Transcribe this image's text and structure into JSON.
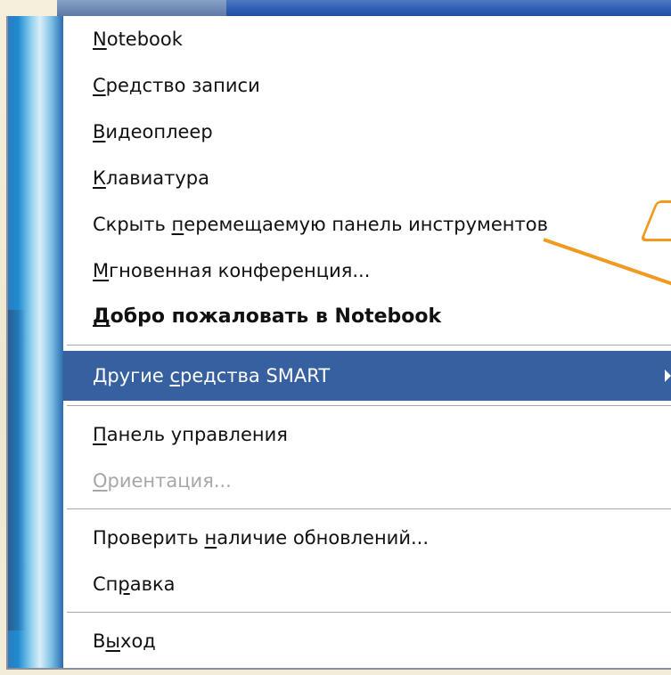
{
  "menu": {
    "items": [
      {
        "before": "",
        "mnemonic": "N",
        "after": "otebook"
      },
      {
        "before": "",
        "mnemonic": "С",
        "after": "редство записи"
      },
      {
        "before": "",
        "mnemonic": "В",
        "after": "идеоплеер"
      },
      {
        "before": "",
        "mnemonic": "К",
        "after": "лавиатура"
      },
      {
        "before": "Скрыть ",
        "mnemonic": "п",
        "after": "еремещаемую панель инструментов"
      },
      {
        "before": "",
        "mnemonic": "М",
        "after": "гновенная конференция..."
      },
      {
        "before": "",
        "mnemonic": "Д",
        "after": "обро пожаловать в Notebook"
      },
      {
        "before": "Другие ",
        "mnemonic": "с",
        "after": "редства SMART"
      },
      {
        "before": "",
        "mnemonic": "П",
        "after": "анель управления"
      },
      {
        "before": "",
        "mnemonic": "О",
        "after": "риентация..."
      },
      {
        "before": "Проверить ",
        "mnemonic": "н",
        "after": "аличие обновлений..."
      },
      {
        "before": "Сп",
        "mnemonic": "р",
        "after": "авка"
      },
      {
        "before": "В",
        "mnemonic": "ы",
        "after": "ход"
      }
    ],
    "highlight_color": "#36609f",
    "disabled_color": "#a7a7a7"
  },
  "annotation": {
    "color": "#f29a1f"
  }
}
